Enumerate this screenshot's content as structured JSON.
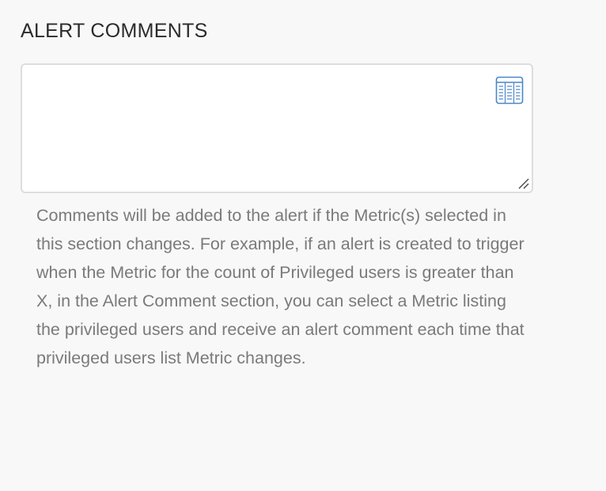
{
  "section": {
    "title": "ALERT COMMENTS"
  },
  "comments_field": {
    "value": "",
    "placeholder": ""
  },
  "icons": {
    "metric_picker": "table-list-icon",
    "resize": "resize-grip-icon"
  },
  "help_text": "Comments will be added to the alert if the Metric(s) selected in this section changes. For example, if an alert is created to trigger when the Metric for the count of Privileged users is greater than X, in the Alert Comment section, you can select a Metric listing the privileged users and receive an alert comment each time that privileged users list Metric changes.",
  "colors": {
    "background": "#f8f8f8",
    "title": "#2b2b2b",
    "field_border": "#dddddd",
    "icon_accent": "#4a86c8",
    "help_text": "#7a7a7a"
  }
}
